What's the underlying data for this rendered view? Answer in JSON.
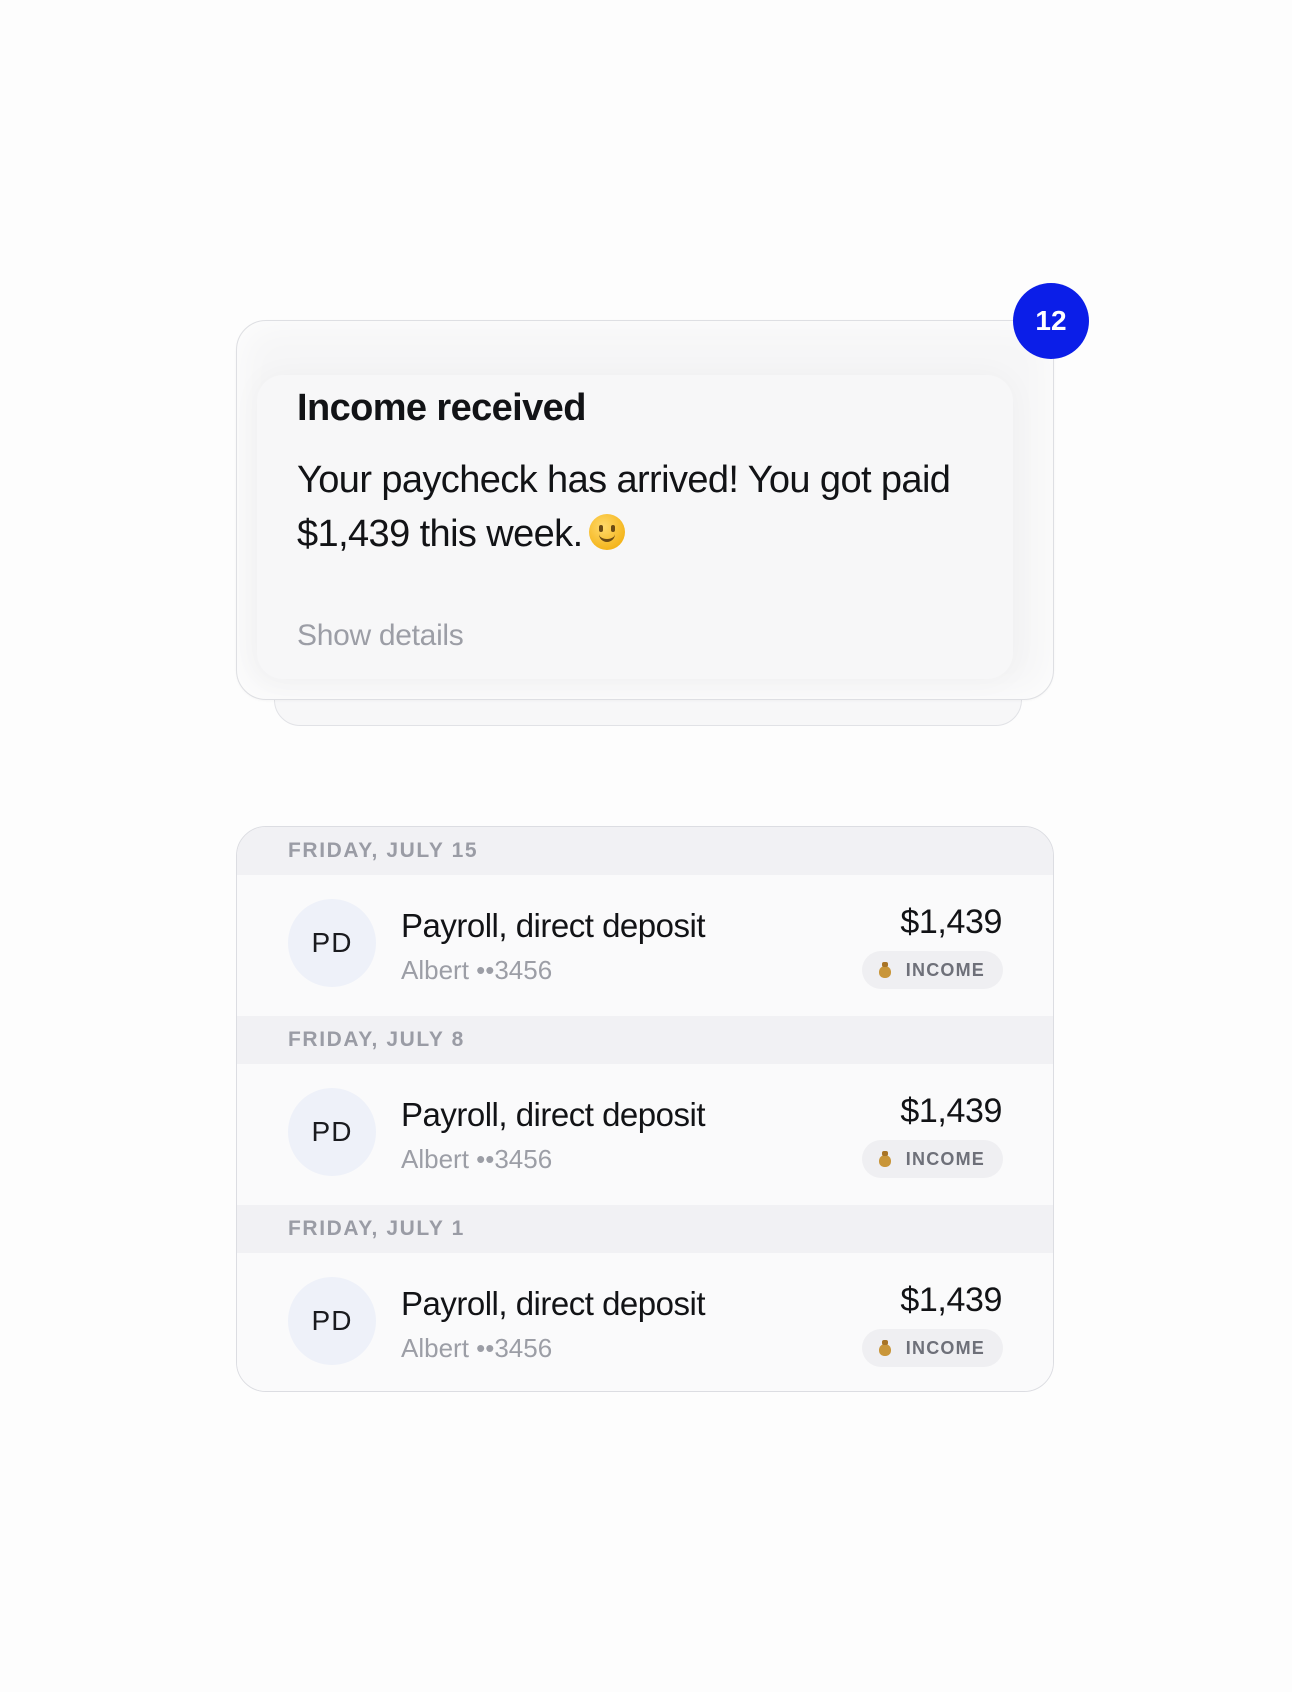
{
  "notification": {
    "title": "Income received",
    "message": "Your paycheck has arrived! You got paid $1,439 this week.",
    "emoji_icon": "slightly-smiling-face-icon",
    "details_link": "Show details",
    "badge_count": "12",
    "badge_color": "#0b1ee8"
  },
  "transactions": [
    {
      "date": "FRIDAY, JULY 15",
      "initials": "PD",
      "name": "Payroll, direct deposit",
      "account": "Albert ••3456",
      "amount": "$1,439",
      "category_icon": "money-bag-icon",
      "category": "INCOME"
    },
    {
      "date": "FRIDAY, JULY 8",
      "initials": "PD",
      "name": "Payroll, direct deposit",
      "account": "Albert ••3456",
      "amount": "$1,439",
      "category_icon": "money-bag-icon",
      "category": "INCOME"
    },
    {
      "date": "FRIDAY, JULY 1",
      "initials": "PD",
      "name": "Payroll, direct deposit",
      "account": "Albert ••3456",
      "amount": "$1,439",
      "category_icon": "money-bag-icon",
      "category": "INCOME"
    }
  ]
}
